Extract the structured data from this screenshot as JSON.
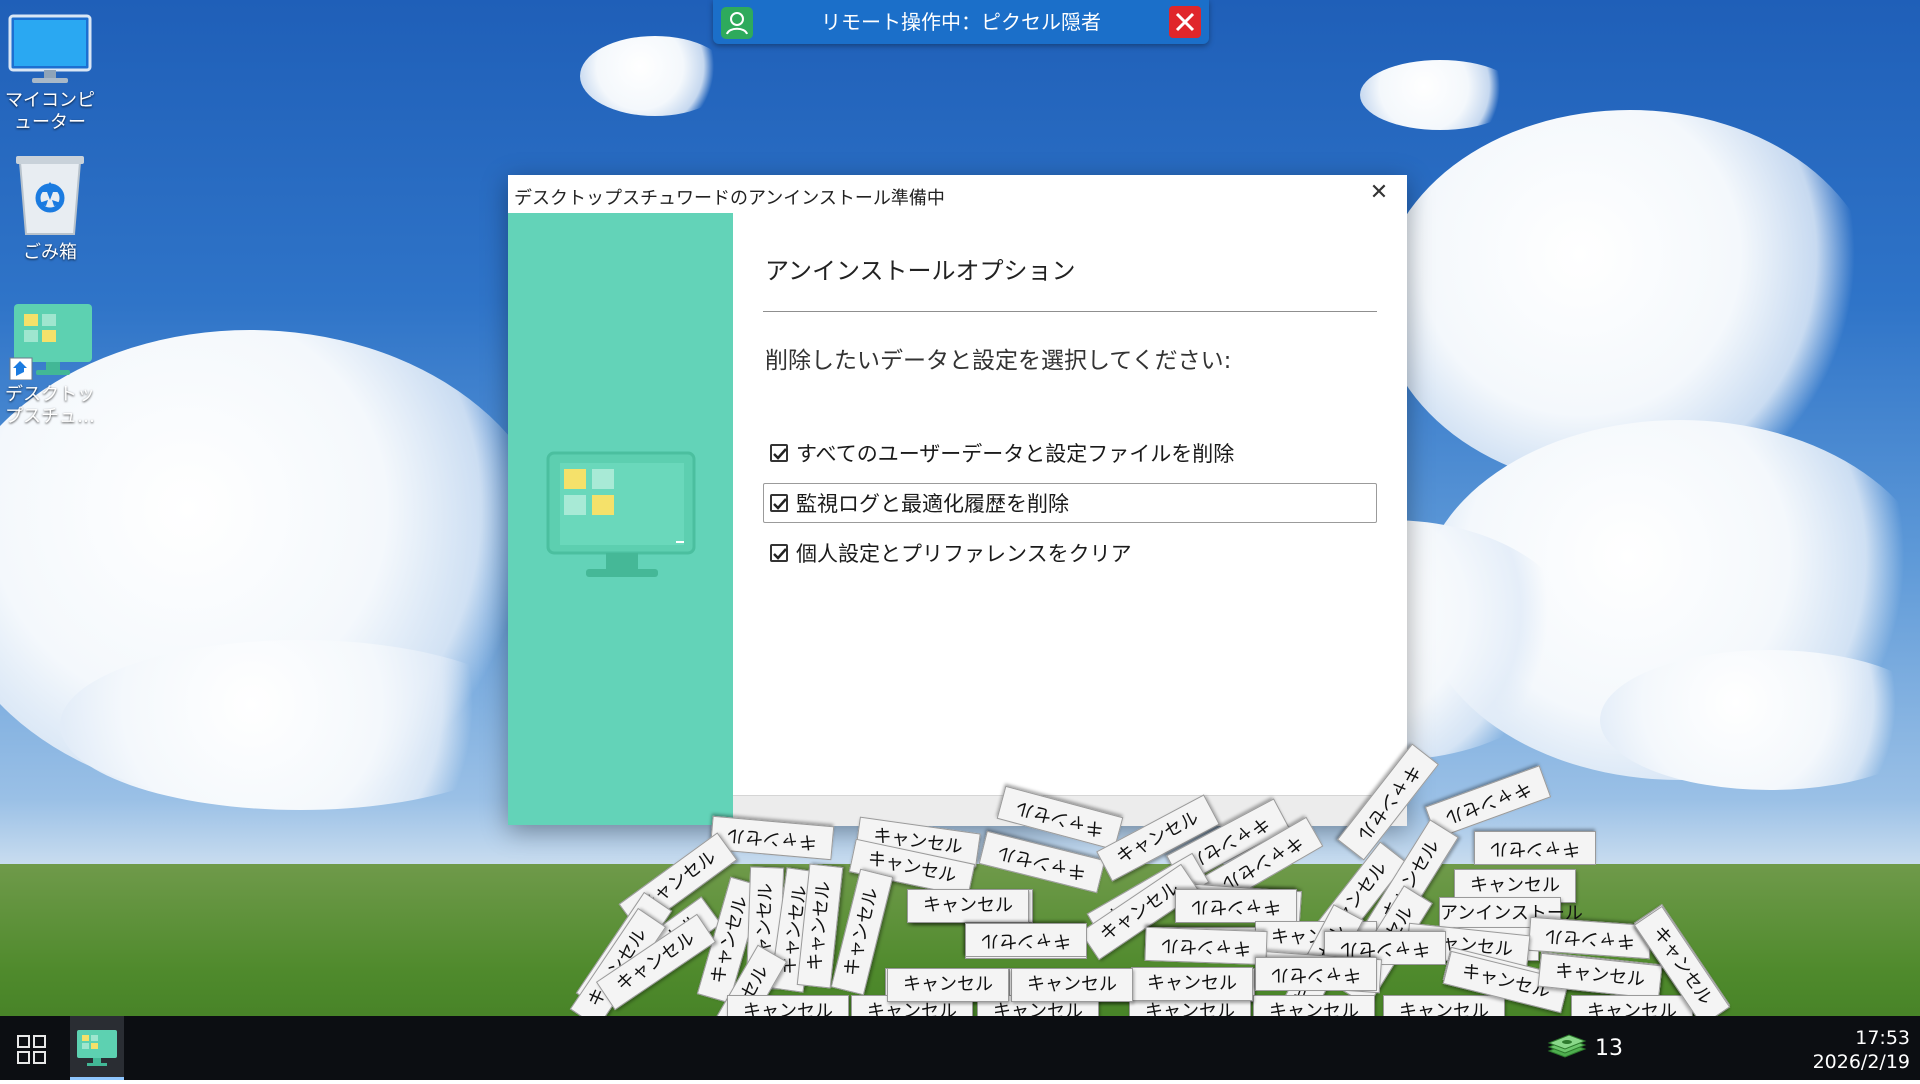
{
  "remote_banner": {
    "text": "リモート操作中：ピクセル隠者"
  },
  "desktop_icons": [
    {
      "label_line1": "マイコンピ",
      "label_line2": "ューター"
    },
    {
      "label_line1": "ごみ箱",
      "label_line2": ""
    },
    {
      "label_line1": "デスクトッ",
      "label_line2": "プスチュ…"
    }
  ],
  "dialog": {
    "title": "デスクトップスチュワードのアンインストール準備中",
    "close_glyph": "✕",
    "heading": "アンインストールオプション",
    "prompt": "削除したいデータと設定を選択してください:",
    "options": [
      {
        "label": "すべてのユーザーデータと設定ファイルを削除",
        "checked": true
      },
      {
        "label": "監視ログと最適化履歴を削除",
        "checked": true
      },
      {
        "label": "個人設定とプリファレンスをクリア",
        "checked": true
      }
    ]
  },
  "pile": {
    "cancel_label": "キャンセル",
    "uninstall_label": "アンインストール"
  },
  "taskbar": {
    "tray_count": "13",
    "time": "17:53",
    "date": "2026/2/19"
  },
  "colors": {
    "dialog_sidebar": "#63d3b8",
    "remote_bar": "#1b6fc9",
    "remote_close": "#e0262b",
    "taskbar": "#0c0e12"
  }
}
